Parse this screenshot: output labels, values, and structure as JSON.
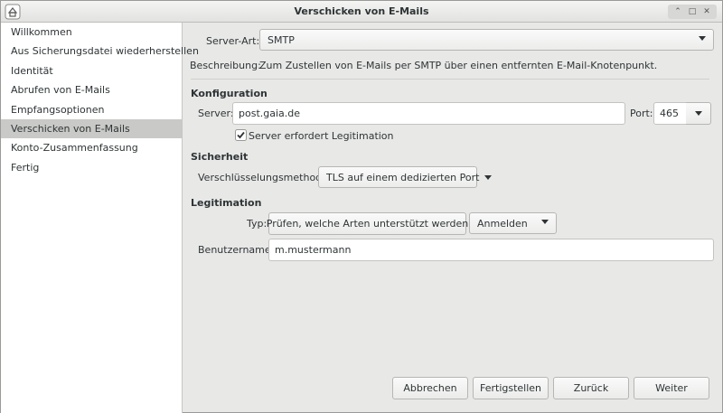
{
  "window": {
    "title": "Verschicken von E-Mails"
  },
  "sidebar": {
    "items": [
      {
        "label": "Willkommen"
      },
      {
        "label": "Aus Sicherungsdatei wiederherstellen"
      },
      {
        "label": "Identität"
      },
      {
        "label": "Abrufen von E-Mails"
      },
      {
        "label": "Empfangsoptionen"
      },
      {
        "label": "Verschicken von E-Mails"
      },
      {
        "label": "Konto-Zusammenfassung"
      },
      {
        "label": "Fertig"
      }
    ],
    "selected": "Verschicken von E-Mails"
  },
  "server_type": {
    "label": "Server-Art:",
    "value": "SMTP"
  },
  "description": {
    "label": "Beschreibung:",
    "text": "Zum Zustellen von E-Mails per SMTP über einen entfernten E-Mail-Knotenpunkt."
  },
  "configuration": {
    "header": "Konfiguration",
    "server_label": "Server:",
    "server_value": "post.gaia.de",
    "port_label": "Port:",
    "port_value": "465",
    "auth_required_label": "Server erfordert Legitimation",
    "auth_required_checked": true
  },
  "security": {
    "header": "Sicherheit",
    "encryption_label": "Verschlüsselungsmethode:",
    "encryption_value": "TLS auf einem dedizierten Port"
  },
  "authentication": {
    "header": "Legitimation",
    "type_label": "Typ:",
    "check_button": "Prüfen, welche Arten unterstützt werden",
    "type_value": "Anmelden",
    "username_label": "Benutzername:",
    "username_value": "m.mustermann"
  },
  "footer": {
    "cancel": "Abbrechen",
    "finish": "Fertigstellen",
    "back": "Zurück",
    "next": "Weiter"
  },
  "colors": {
    "selection": "#c9c9c7",
    "window_bg": "#e8e8e7",
    "sidebar_bg": "#ffffff"
  }
}
